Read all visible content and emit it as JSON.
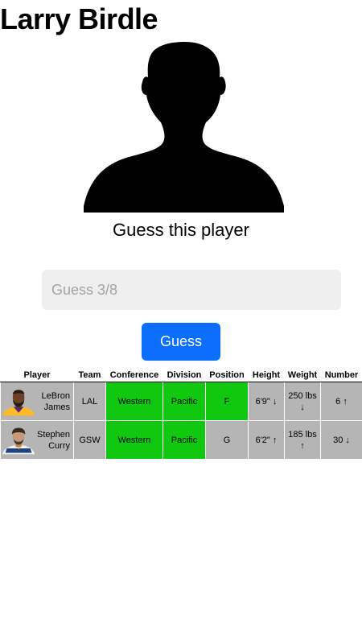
{
  "app": {
    "title": "Larry Birdle"
  },
  "prompt": "Guess this player",
  "guess_input": {
    "value": "",
    "placeholder": "Guess 3/8"
  },
  "guess_button": {
    "label": "Guess"
  },
  "colors": {
    "match": "#0fc80f",
    "miss": "#b5b5b5",
    "button": "#0d6efd"
  },
  "table": {
    "headers": {
      "player": "Player",
      "team": "Team",
      "conference": "Conference",
      "division": "Division",
      "position": "Position",
      "height": "Height",
      "weight": "Weight",
      "number": "Number"
    },
    "rows": [
      {
        "avatar_icon": "lebron-james-headshot-icon",
        "player": "LeBron James",
        "team": "LAL",
        "conference": "Western",
        "division": "Pacific",
        "position": "F",
        "height": "6'9\" ↓",
        "weight": "250 lbs ↓",
        "number": "6 ↑",
        "matches": [
          "conference",
          "division",
          "position"
        ]
      },
      {
        "avatar_icon": "stephen-curry-headshot-icon",
        "player": "Stephen Curry",
        "team": "GSW",
        "conference": "Western",
        "division": "Pacific",
        "position": "G",
        "height": "6'2\" ↑",
        "weight": "185 lbs ↑",
        "number": "30 ↓",
        "matches": [
          "conference",
          "division"
        ]
      }
    ]
  }
}
